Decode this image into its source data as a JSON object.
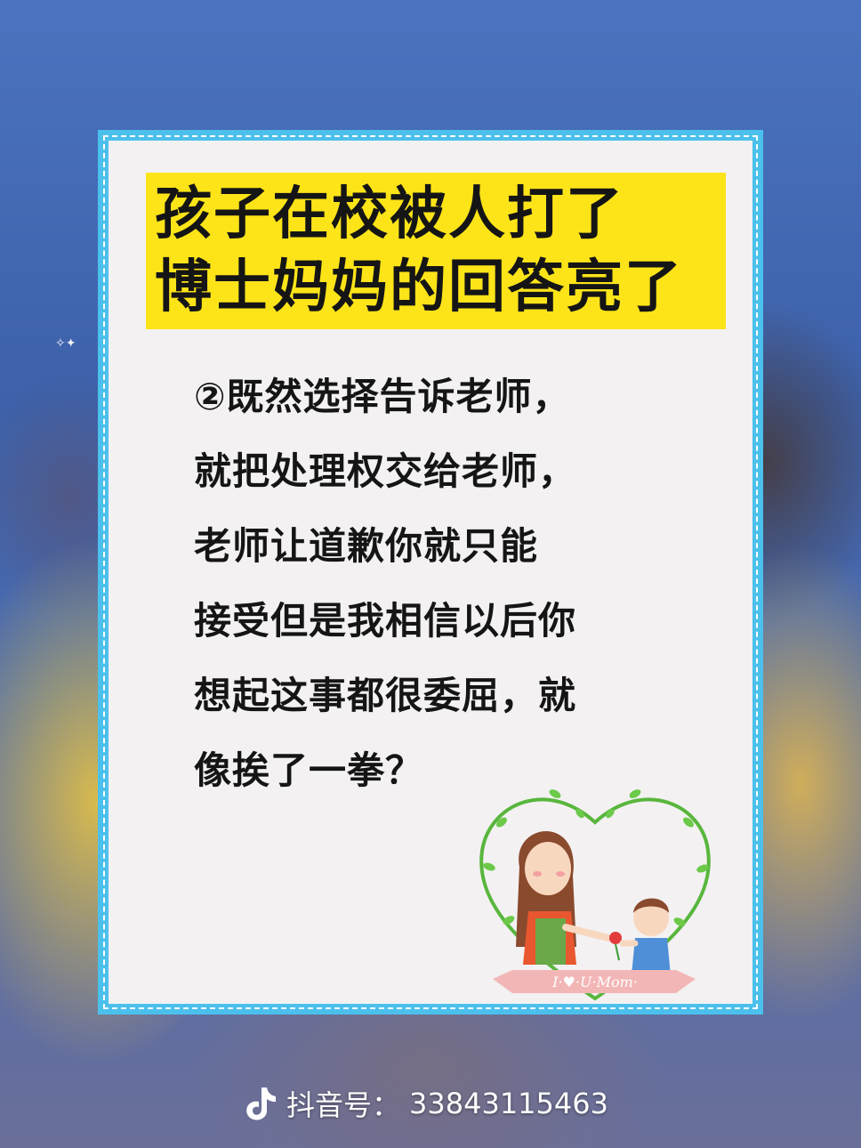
{
  "title": {
    "line1": "孩子在校被人打了",
    "line2": "博士妈妈的回答亮了"
  },
  "body": {
    "lines": [
      "②既然选择告诉老师，",
      "就把处理权交给老师，",
      "老师让道歉你就只能",
      "接受但是我相信以后你",
      "想起这事都很委屈，就",
      "像挨了一拳？"
    ]
  },
  "illustration": {
    "ribbon_text": "I·♥·U·Mom·"
  },
  "footer": {
    "label": "抖音号：",
    "account_id": "33843115463",
    "icon": "douyin-logo-icon"
  },
  "colors": {
    "card_border": "#4cc0ec",
    "title_highlight": "#fde418",
    "card_background": "#f3f1f2"
  }
}
